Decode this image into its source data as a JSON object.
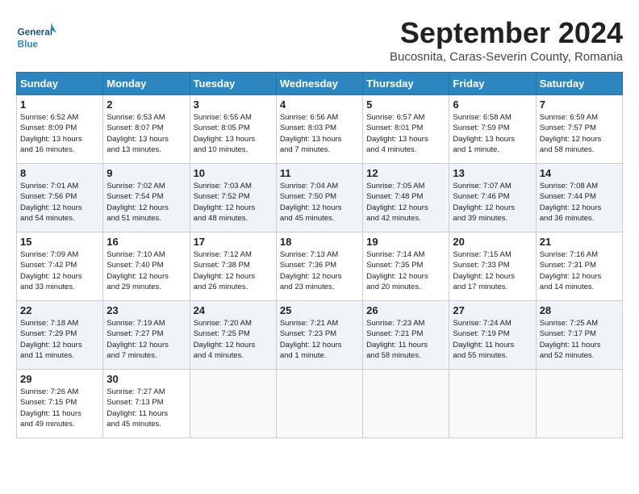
{
  "header": {
    "logo_general": "General",
    "logo_blue": "Blue",
    "month": "September 2024",
    "location": "Bucosnita, Caras-Severin County, Romania"
  },
  "weekdays": [
    "Sunday",
    "Monday",
    "Tuesday",
    "Wednesday",
    "Thursday",
    "Friday",
    "Saturday"
  ],
  "weeks": [
    [
      {
        "day": "1",
        "info": "Sunrise: 6:52 AM\nSunset: 8:09 PM\nDaylight: 13 hours\nand 16 minutes."
      },
      {
        "day": "2",
        "info": "Sunrise: 6:53 AM\nSunset: 8:07 PM\nDaylight: 13 hours\nand 13 minutes."
      },
      {
        "day": "3",
        "info": "Sunrise: 6:55 AM\nSunset: 8:05 PM\nDaylight: 13 hours\nand 10 minutes."
      },
      {
        "day": "4",
        "info": "Sunrise: 6:56 AM\nSunset: 8:03 PM\nDaylight: 13 hours\nand 7 minutes."
      },
      {
        "day": "5",
        "info": "Sunrise: 6:57 AM\nSunset: 8:01 PM\nDaylight: 13 hours\nand 4 minutes."
      },
      {
        "day": "6",
        "info": "Sunrise: 6:58 AM\nSunset: 7:59 PM\nDaylight: 13 hours\nand 1 minute."
      },
      {
        "day": "7",
        "info": "Sunrise: 6:59 AM\nSunset: 7:57 PM\nDaylight: 12 hours\nand 58 minutes."
      }
    ],
    [
      {
        "day": "8",
        "info": "Sunrise: 7:01 AM\nSunset: 7:56 PM\nDaylight: 12 hours\nand 54 minutes."
      },
      {
        "day": "9",
        "info": "Sunrise: 7:02 AM\nSunset: 7:54 PM\nDaylight: 12 hours\nand 51 minutes."
      },
      {
        "day": "10",
        "info": "Sunrise: 7:03 AM\nSunset: 7:52 PM\nDaylight: 12 hours\nand 48 minutes."
      },
      {
        "day": "11",
        "info": "Sunrise: 7:04 AM\nSunset: 7:50 PM\nDaylight: 12 hours\nand 45 minutes."
      },
      {
        "day": "12",
        "info": "Sunrise: 7:05 AM\nSunset: 7:48 PM\nDaylight: 12 hours\nand 42 minutes."
      },
      {
        "day": "13",
        "info": "Sunrise: 7:07 AM\nSunset: 7:46 PM\nDaylight: 12 hours\nand 39 minutes."
      },
      {
        "day": "14",
        "info": "Sunrise: 7:08 AM\nSunset: 7:44 PM\nDaylight: 12 hours\nand 36 minutes."
      }
    ],
    [
      {
        "day": "15",
        "info": "Sunrise: 7:09 AM\nSunset: 7:42 PM\nDaylight: 12 hours\nand 33 minutes."
      },
      {
        "day": "16",
        "info": "Sunrise: 7:10 AM\nSunset: 7:40 PM\nDaylight: 12 hours\nand 29 minutes."
      },
      {
        "day": "17",
        "info": "Sunrise: 7:12 AM\nSunset: 7:38 PM\nDaylight: 12 hours\nand 26 minutes."
      },
      {
        "day": "18",
        "info": "Sunrise: 7:13 AM\nSunset: 7:36 PM\nDaylight: 12 hours\nand 23 minutes."
      },
      {
        "day": "19",
        "info": "Sunrise: 7:14 AM\nSunset: 7:35 PM\nDaylight: 12 hours\nand 20 minutes."
      },
      {
        "day": "20",
        "info": "Sunrise: 7:15 AM\nSunset: 7:33 PM\nDaylight: 12 hours\nand 17 minutes."
      },
      {
        "day": "21",
        "info": "Sunrise: 7:16 AM\nSunset: 7:31 PM\nDaylight: 12 hours\nand 14 minutes."
      }
    ],
    [
      {
        "day": "22",
        "info": "Sunrise: 7:18 AM\nSunset: 7:29 PM\nDaylight: 12 hours\nand 11 minutes."
      },
      {
        "day": "23",
        "info": "Sunrise: 7:19 AM\nSunset: 7:27 PM\nDaylight: 12 hours\nand 7 minutes."
      },
      {
        "day": "24",
        "info": "Sunrise: 7:20 AM\nSunset: 7:25 PM\nDaylight: 12 hours\nand 4 minutes."
      },
      {
        "day": "25",
        "info": "Sunrise: 7:21 AM\nSunset: 7:23 PM\nDaylight: 12 hours\nand 1 minute."
      },
      {
        "day": "26",
        "info": "Sunrise: 7:23 AM\nSunset: 7:21 PM\nDaylight: 11 hours\nand 58 minutes."
      },
      {
        "day": "27",
        "info": "Sunrise: 7:24 AM\nSunset: 7:19 PM\nDaylight: 11 hours\nand 55 minutes."
      },
      {
        "day": "28",
        "info": "Sunrise: 7:25 AM\nSunset: 7:17 PM\nDaylight: 11 hours\nand 52 minutes."
      }
    ],
    [
      {
        "day": "29",
        "info": "Sunrise: 7:26 AM\nSunset: 7:15 PM\nDaylight: 11 hours\nand 49 minutes."
      },
      {
        "day": "30",
        "info": "Sunrise: 7:27 AM\nSunset: 7:13 PM\nDaylight: 11 hours\nand 45 minutes."
      },
      {
        "day": "",
        "info": ""
      },
      {
        "day": "",
        "info": ""
      },
      {
        "day": "",
        "info": ""
      },
      {
        "day": "",
        "info": ""
      },
      {
        "day": "",
        "info": ""
      }
    ]
  ]
}
